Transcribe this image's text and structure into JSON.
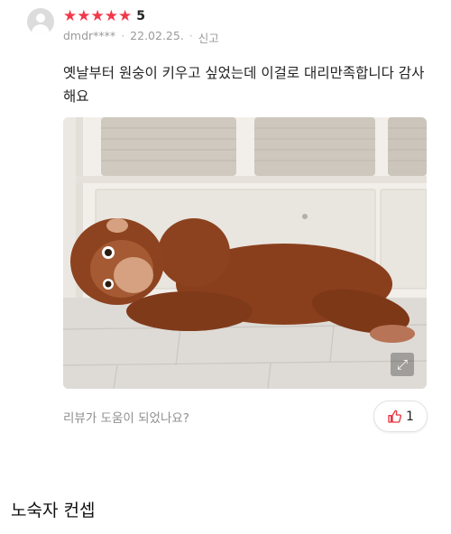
{
  "review": {
    "rating": "5",
    "stars": 5,
    "star_char": "★",
    "username": "dmdr****",
    "date": "22.02.25.",
    "separator": "·",
    "report_label": "신고",
    "text": "옛날부터 원숭이 키우고 싶었는데 이걸로 대리만족합니다 감사해요",
    "helpful_question": "리뷰가 도움이 되었나요?",
    "like_count": "1"
  },
  "caption": "노숙자 컨셉",
  "colors": {
    "star": "#f2384b",
    "like_icon": "#e8323f"
  }
}
